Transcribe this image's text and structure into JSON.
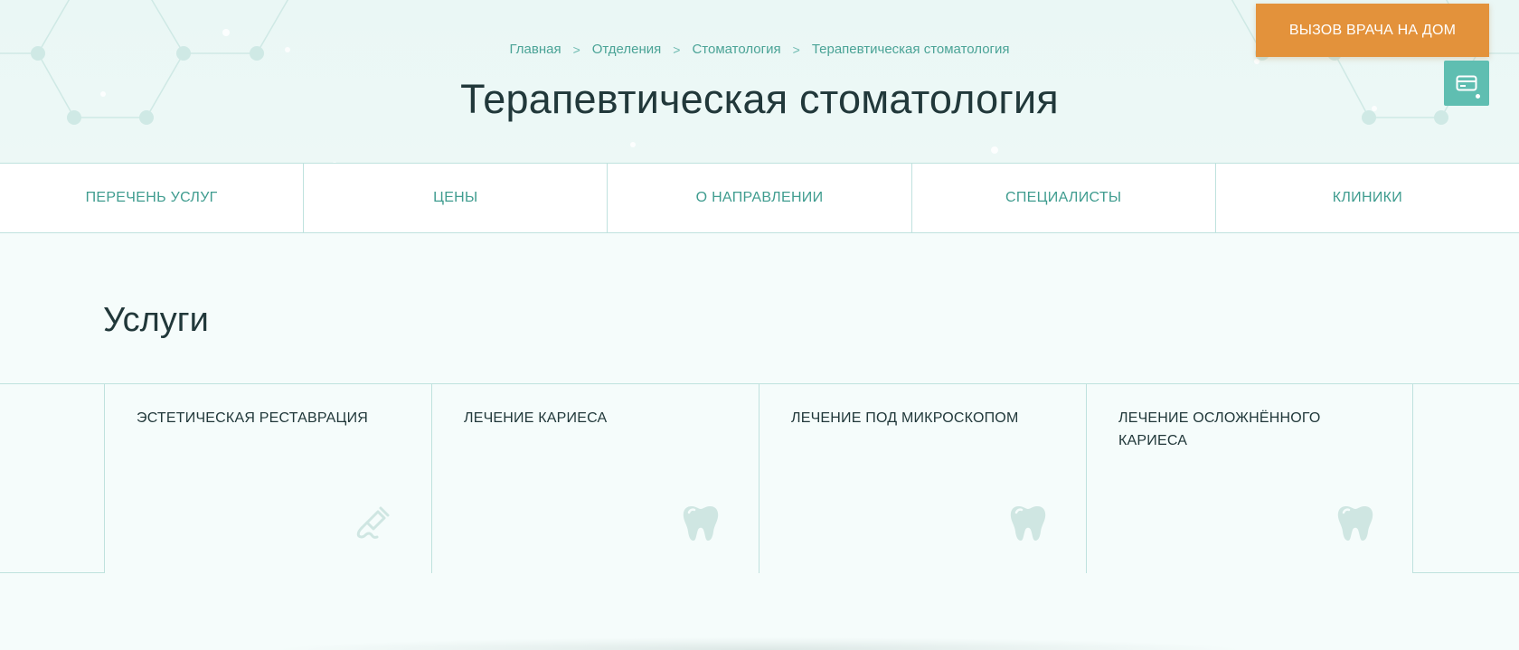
{
  "breadcrumb": {
    "items": [
      "Главная",
      "Отделения",
      "Стоматология",
      "Терапевтическая стоматология"
    ],
    "separator": ">"
  },
  "page": {
    "title": "Терапевтическая стоматология"
  },
  "header": {
    "call_doctor_label": "ВЫЗОВ ВРАЧА НА ДОМ",
    "card_icon": "credit-card-icon"
  },
  "tabs": [
    {
      "label": "ПЕРЕЧЕНЬ УСЛУГ"
    },
    {
      "label": "ЦЕНЫ"
    },
    {
      "label": "О НАПРАВЛЕНИИ"
    },
    {
      "label": "СПЕЦИАЛИСТЫ"
    },
    {
      "label": "КЛИНИКИ"
    }
  ],
  "services": {
    "title": "Услуги",
    "items": [
      {
        "name": "ЭСТЕТИЧЕСКАЯ РЕСТАВРАЦИЯ",
        "icon": "dental-drill-icon"
      },
      {
        "name": "ЛЕЧЕНИЕ КАРИЕСА",
        "icon": "tooth-icon"
      },
      {
        "name": "ЛЕЧЕНИЕ ПОД МИКРОСКОПОМ",
        "icon": "tooth-icon"
      },
      {
        "name": "ЛЕЧЕНИЕ ОСЛОЖНЁННОГО КАРИЕСА",
        "icon": "tooth-icon"
      }
    ]
  },
  "colors": {
    "accent": "#4aa396",
    "call_button": "#e3923b",
    "card_button": "#5fbeb1",
    "border": "#bfe2de"
  }
}
